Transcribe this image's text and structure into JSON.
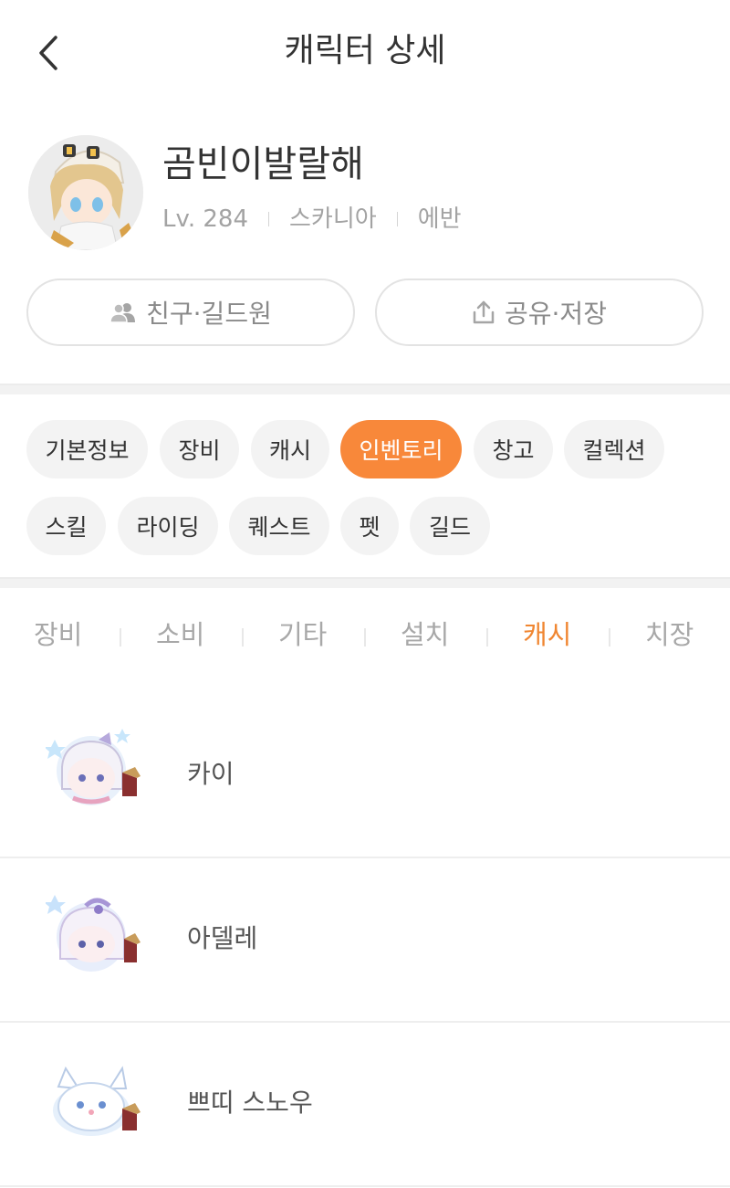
{
  "header": {
    "title": "캐릭터 상세",
    "back_icon": "chevron-left-icon"
  },
  "profile": {
    "name": "곰빈이발랄해",
    "level": "Lv. 284",
    "world": "스카니아",
    "job": "에반",
    "friends_button": "친구·길드원",
    "friends_icon": "people-icon",
    "share_button": "공유·저장",
    "share_icon": "share-icon"
  },
  "tabs": [
    {
      "label": "기본정보",
      "active": false
    },
    {
      "label": "장비",
      "active": false
    },
    {
      "label": "캐시",
      "active": false
    },
    {
      "label": "인벤토리",
      "active": true
    },
    {
      "label": "창고",
      "active": false
    },
    {
      "label": "컬렉션",
      "active": false
    },
    {
      "label": "스킬",
      "active": false
    },
    {
      "label": "라이딩",
      "active": false
    },
    {
      "label": "퀘스트",
      "active": false
    },
    {
      "label": "펫",
      "active": false
    },
    {
      "label": "길드",
      "active": false
    }
  ],
  "subtabs": [
    {
      "label": "장비",
      "active": false
    },
    {
      "label": "소비",
      "active": false
    },
    {
      "label": "기타",
      "active": false
    },
    {
      "label": "설치",
      "active": false
    },
    {
      "label": "캐시",
      "active": true
    },
    {
      "label": "치장",
      "active": false
    }
  ],
  "items": [
    {
      "name": "카이",
      "icon": "pet-kai-icon"
    },
    {
      "name": "아델레",
      "icon": "pet-adele-icon"
    },
    {
      "name": "쁘띠 스노우",
      "icon": "pet-snow-fox-icon"
    }
  ],
  "colors": {
    "accent": "#f8883a",
    "accent_text": "#f08631",
    "chip_bg": "#f3f3f3",
    "muted_text": "#a3a3a3"
  }
}
